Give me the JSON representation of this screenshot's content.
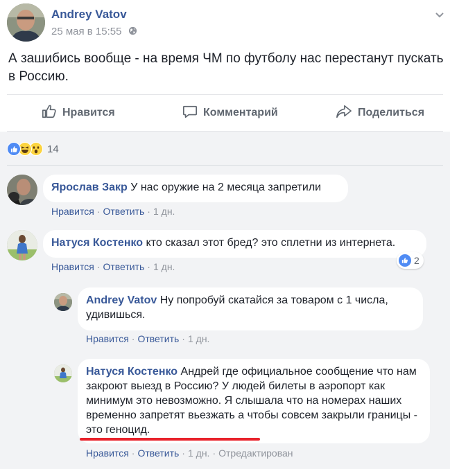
{
  "post": {
    "author": "Andrey Vatov",
    "time": "25 мая в 15:55",
    "text": "А зашибись вообще - на время ЧМ по футболу нас перестанут пускать в Россию."
  },
  "actions": {
    "like": "Нравится",
    "comment": "Комментарий",
    "share": "Поделиться"
  },
  "reactions": {
    "icons": [
      "like-icon",
      "haha-icon",
      "wow-icon"
    ],
    "count": "14"
  },
  "comments": [
    {
      "author": "Ярослав Закр",
      "text": "У нас оружие на 2 месяца запретили",
      "like": "Нравится",
      "reply": "Ответить",
      "time": "1 дн."
    },
    {
      "author": "Натуся Костенко",
      "text": "кто сказал этот бред? это сплетни из интернета.",
      "like": "Нравится",
      "reply": "Ответить",
      "time": "1 дн.",
      "reaction_count": "2"
    },
    {
      "author": "Andrey Vatov",
      "text": "Ну попробуй скатайся за товаром с 1 числа, удивишься.",
      "like": "Нравится",
      "reply": "Ответить",
      "time": "1 дн."
    },
    {
      "author": "Натуся Костенко",
      "text": "Андрей где официальное сообщение что нам закроют выезд в Россию? У людей билеты в аэропорт как минимум это невозможно. Я слышала что на номерах наших временно запретят вьезжать а чтобы совсем закрыли границы - это геноцид.",
      "like": "Нравится",
      "reply": "Ответить",
      "time": "1 дн.",
      "edited": "Отредактирован"
    }
  ],
  "colors": {
    "link": "#385898",
    "meta": "#90949c",
    "comment_bg": "#ffffff",
    "section_bg": "#f2f3f5",
    "annotation": "#e8222b"
  }
}
